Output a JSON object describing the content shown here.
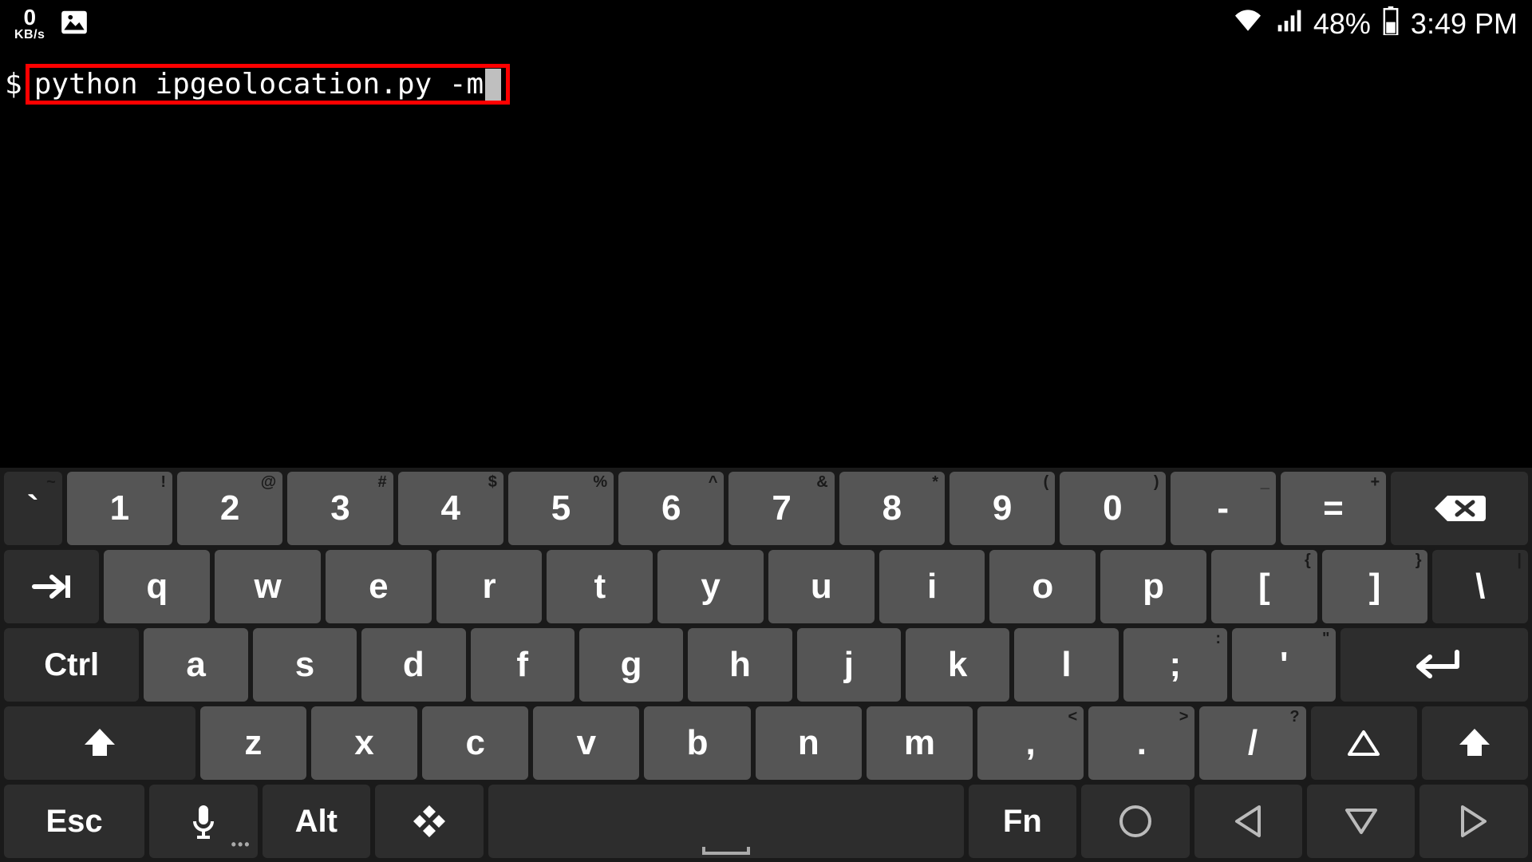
{
  "status_bar": {
    "net_speed_value": "0",
    "net_speed_unit": "KB/s",
    "battery_percent": "48%",
    "clock": "3:49 PM"
  },
  "terminal": {
    "prompt": "$",
    "command": "python ipgeolocation.py -m"
  },
  "keyboard": {
    "row1": {
      "k0": {
        "main": "`",
        "shift": "~"
      },
      "k1": {
        "main": "1",
        "shift": "!"
      },
      "k2": {
        "main": "2",
        "shift": "@"
      },
      "k3": {
        "main": "3",
        "shift": "#"
      },
      "k4": {
        "main": "4",
        "shift": "$"
      },
      "k5": {
        "main": "5",
        "shift": "%"
      },
      "k6": {
        "main": "6",
        "shift": "^"
      },
      "k7": {
        "main": "7",
        "shift": "&"
      },
      "k8": {
        "main": "8",
        "shift": "*"
      },
      "k9": {
        "main": "9",
        "shift": "("
      },
      "k10": {
        "main": "0",
        "shift": ")"
      },
      "k11": {
        "main": "-",
        "shift": "_"
      },
      "k12": {
        "main": "=",
        "shift": "+"
      }
    },
    "row2": {
      "q": "q",
      "w": "w",
      "e": "e",
      "r": "r",
      "t": "t",
      "y": "y",
      "u": "u",
      "i": "i",
      "o": "o",
      "p": "p",
      "lb": {
        "main": "[",
        "shift": "{"
      },
      "rb": {
        "main": "]",
        "shift": "}"
      },
      "bs": {
        "main": "\\",
        "shift": "|"
      }
    },
    "row3": {
      "ctrl": "Ctrl",
      "a": "a",
      "s": "s",
      "d": "d",
      "f": "f",
      "g": "g",
      "h": "h",
      "j": "j",
      "k": "k",
      "l": "l",
      "sc": {
        "main": ";",
        "shift": ":"
      },
      "qt": {
        "main": "'",
        "shift": "\""
      }
    },
    "row4": {
      "z": "z",
      "x": "x",
      "c": "c",
      "v": "v",
      "b": "b",
      "n": "n",
      "m": "m",
      "cm": {
        "main": ",",
        "shift": "<"
      },
      "dt": {
        "main": ".",
        "shift": ">"
      },
      "sl": {
        "main": "/",
        "shift": "?"
      }
    },
    "row5": {
      "esc": "Esc",
      "alt": "Alt",
      "fn": "Fn"
    }
  }
}
